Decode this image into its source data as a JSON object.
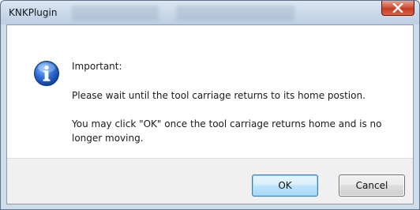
{
  "window": {
    "title": "KNKPlugin"
  },
  "message": {
    "heading": "Important:",
    "line1": "Please wait until the tool carriage returns to its home postion.",
    "line2": "You may click \"OK\" once the tool carriage returns home and is no longer moving."
  },
  "buttons": {
    "ok_label": "OK",
    "cancel_label": "Cancel"
  },
  "icons": {
    "dialog_icon": "information-icon",
    "close": "close-icon"
  },
  "colors": {
    "info_icon": "#2a64c8",
    "close_button": "#c9432b",
    "ok_border": "#3c7fb1"
  }
}
